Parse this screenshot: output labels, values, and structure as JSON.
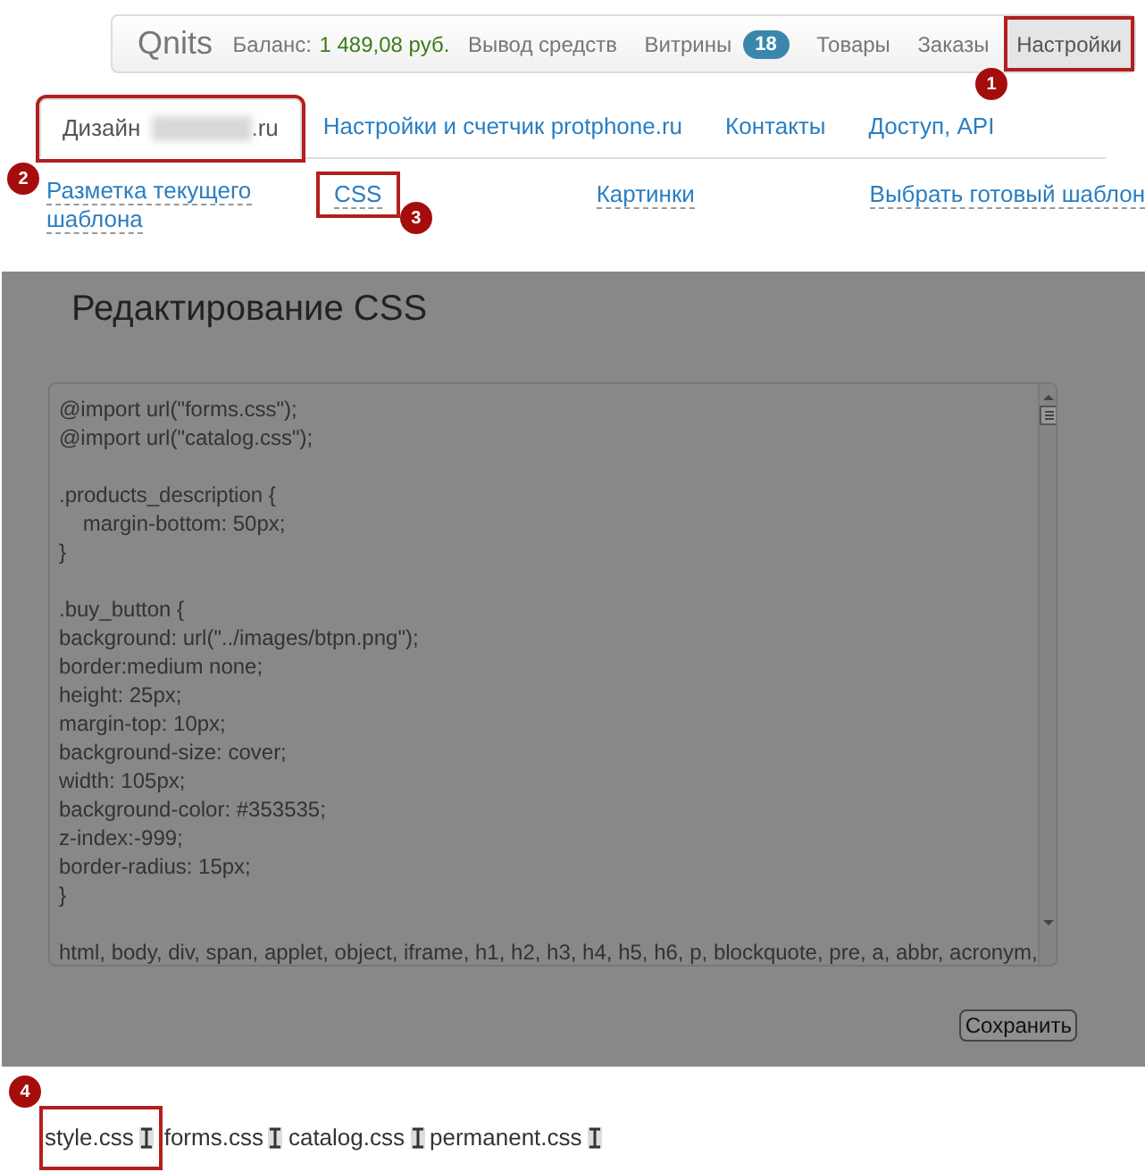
{
  "navbar": {
    "brand": "Qnits",
    "balance_label": "Баланс:",
    "balance_value": "1 489,08 руб.",
    "items": [
      {
        "label": "Вывод средств",
        "selected": false,
        "highlighted": false
      },
      {
        "label": "Витрины",
        "badge": "18",
        "selected": false,
        "highlighted": false
      },
      {
        "label": "Товары",
        "selected": false,
        "highlighted": false
      },
      {
        "label": "Заказы",
        "selected": false,
        "highlighted": false
      },
      {
        "label": "Настройки",
        "selected": true,
        "highlighted": true,
        "callout": "1"
      }
    ]
  },
  "tabs": [
    {
      "label": "Дизайн",
      "suffix": ".ru",
      "redacted": true,
      "selected": true,
      "highlighted": true,
      "callout": "2"
    },
    {
      "label": "Настройки и счетчик protphone.ru",
      "selected": false,
      "highlighted": false
    },
    {
      "label": "Контакты",
      "selected": false,
      "highlighted": false
    },
    {
      "label": "Доступ, API",
      "selected": false,
      "highlighted": false
    }
  ],
  "subnav": [
    {
      "label": "Разметка текущего шаблона",
      "highlighted": false
    },
    {
      "label": "CSS",
      "highlighted": true,
      "callout": "3"
    },
    {
      "label": "Картинки",
      "highlighted": false
    },
    {
      "label": "Выбрать готовый шаблон",
      "highlighted": false
    }
  ],
  "editor": {
    "title": "Редактирование CSS",
    "blocks": [
      [
        "@import url(\"forms.css\");",
        "@import url(\"catalog.css\");"
      ],
      [
        ".products_description {",
        "    margin-bottom: 50px;",
        "}"
      ],
      [
        ".buy_button {",
        "background: url(\"../images/btpn.png\");",
        "border:medium none;",
        "height: 25px;",
        "margin-top: 10px;",
        "background-size: cover;",
        "width: 105px;",
        "background-color: #353535;",
        "z-index:-999;",
        "border-radius: 15px;",
        "}"
      ],
      [
        "html, body, div, span, applet, object, iframe, h1, h2, h3, h4, h5, h6, p, blockquote, pre, a, abbr, acronym,"
      ]
    ],
    "save_button": "Сохранить"
  },
  "files": {
    "callout": "4",
    "items": [
      {
        "name": "style.css",
        "highlighted": true
      },
      {
        "name": "forms.css",
        "highlighted": false
      },
      {
        "name": "catalog.css",
        "highlighted": false
      },
      {
        "name": "permanent.css",
        "highlighted": false
      }
    ]
  }
}
